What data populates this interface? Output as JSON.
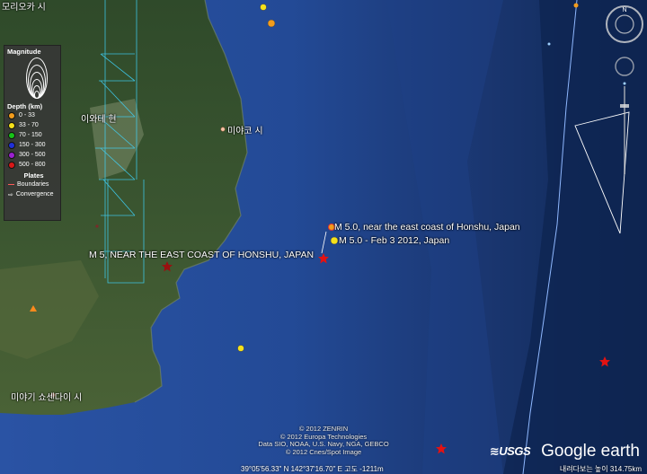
{
  "legend": {
    "magnitude_title": "Magnitude",
    "magnitudes": [
      "8",
      "7",
      "6",
      "5",
      "4",
      "3"
    ],
    "depth_title": "Depth (km)",
    "depth_items": [
      {
        "label": "0 - 33",
        "color": "#f39c1c"
      },
      {
        "label": "33 - 70",
        "color": "#f5e11a"
      },
      {
        "label": "70 - 150",
        "color": "#17c317"
      },
      {
        "label": "150 - 300",
        "color": "#2030d8"
      },
      {
        "label": "300 - 500",
        "color": "#9b20d0"
      },
      {
        "label": "500 - 800",
        "color": "#d81818"
      }
    ],
    "plates_title": "Plates",
    "boundaries_label": "Boundaries",
    "convergence_label": "Convergence"
  },
  "places": {
    "miyako": "미야코 시",
    "iwate": "이와테 현",
    "sendai": "미야기 쇼센다이 시",
    "top": "모리오카 시"
  },
  "events": {
    "e1": "M 5.0, near the east coast of Honshu, Japan",
    "e2": "M 5.0 - Feb  3 2012, Japan",
    "e3": "M 5, NEAR THE EAST COAST OF HONSHU, JAPAN"
  },
  "credits": {
    "line1": "© 2012 ZENRIN",
    "line2": "© 2012 Europa Technologies",
    "line3": "Data SIO, NOAA, U.S. Navy, NGA, GEBCO",
    "line4": "© 2012 Cnes/Spot Image"
  },
  "logos": {
    "usgs": "≋USGS",
    "ge": "Google earth"
  },
  "status": {
    "coords": "39°05'56.33\" N 142°37'16.70\" E 고도 -1211m",
    "eye": "내려다보는 높이 314.75km"
  },
  "compass_letter": "N"
}
